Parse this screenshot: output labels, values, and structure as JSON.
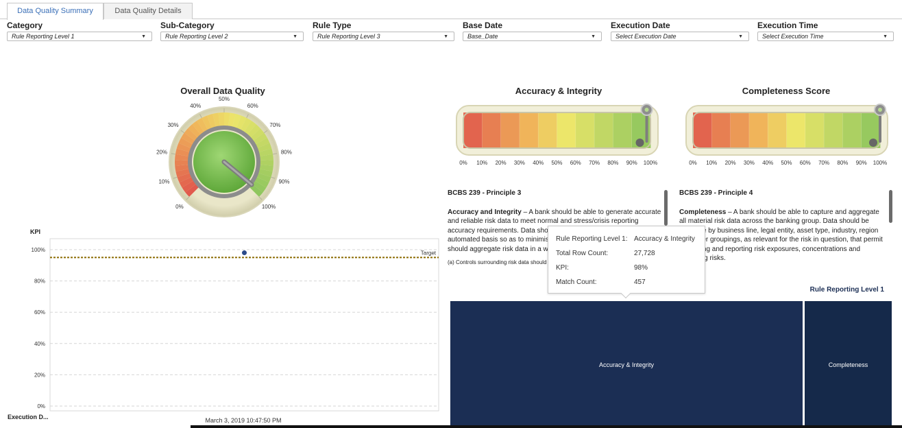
{
  "tabs": [
    {
      "label": "Data Quality Summary",
      "active": true
    },
    {
      "label": "Data Quality Details",
      "active": false
    }
  ],
  "filters": {
    "category": {
      "label": "Category",
      "value": "Rule Reporting Level 1"
    },
    "subcategory": {
      "label": "Sub-Category",
      "value": "Rule Reporting Level 2"
    },
    "rule_type": {
      "label": "Rule Type",
      "value": "Rule Reporting Level 3"
    },
    "base_date": {
      "label": "Base Date",
      "value": "Base_Date"
    },
    "execution_date": {
      "label": "Execution Date",
      "value": "Select Execution Date"
    },
    "execution_time": {
      "label": "Execution Time",
      "value": "Select Execution Time"
    }
  },
  "overall_gauge": {
    "title": "Overall Data Quality",
    "ticks": [
      "0%",
      "10%",
      "20%",
      "30%",
      "40%",
      "50%",
      "60%",
      "70%",
      "80%",
      "90%",
      "100%"
    ],
    "value": 0.98
  },
  "accuracy_bar": {
    "title": "Accuracy & Integrity",
    "ticks": [
      "0%",
      "10%",
      "20%",
      "30%",
      "40%",
      "50%",
      "60%",
      "70%",
      "80%",
      "90%",
      "100%"
    ],
    "value": 0.98
  },
  "completeness_bar": {
    "title": "Completeness Score",
    "ticks": [
      "0%",
      "10%",
      "20%",
      "30%",
      "40%",
      "50%",
      "60%",
      "70%",
      "80%",
      "90%",
      "100%"
    ],
    "value": 1.0
  },
  "principle3": {
    "title": "BCBS 239 - Principle 3",
    "lead": "Accuracy and Integrity",
    "body": " – A bank should be able to generate accurate and reliable risk data to meet normal and stress/crisis reporting accuracy requirements. Data should be aggregated on a largely automated basis so as to minimise the probability of errors. Banks should aggregate risk data in a way",
    "small": "(a) Controls surrounding risk data should be as robust as"
  },
  "principle4": {
    "title": "BCBS 239 - Principle 4",
    "lead": "Completeness",
    "body": " – A bank should be able to capture and aggregate all material risk data across the banking group. Data should be available by business line, legal entity, asset type, industry, region and other groupings, as relevant for the risk in question, that permit identifying and reporting risk exposures, concentrations and emerging risks."
  },
  "tooltip": {
    "rows": [
      {
        "label": "Rule Reporting Level 1:",
        "value": "Accuracy & Integrity"
      },
      {
        "label": "Total Row Count:",
        "value": "27,728"
      },
      {
        "label": "KPI:",
        "value": "98%"
      },
      {
        "label": "Match Count:",
        "value": "457"
      }
    ]
  },
  "treemap": {
    "legend_title": "Rule Reporting Level 1",
    "tiles": [
      {
        "label": "Accuracy & Integrity",
        "color": "#1b2e54"
      },
      {
        "label": "Completeness",
        "color": "#15294a"
      }
    ]
  },
  "kpi_chart": {
    "ylabel": "KPI",
    "xlabel": "Execution D...",
    "target_label": "Target",
    "yticks": [
      "0%",
      "20%",
      "40%",
      "60%",
      "80%",
      "100%"
    ],
    "category": "March 3, 2019 10:47:50 PM"
  },
  "chart_data": {
    "type": "scatter",
    "title": "",
    "ylabel": "KPI",
    "xlabel": "Execution D...",
    "categories": [
      "March 3, 2019 10:47:50 PM"
    ],
    "series": [
      {
        "values": [
          98
        ]
      }
    ],
    "target": 95,
    "ylim": [
      0,
      100
    ],
    "grid": true
  },
  "colors": {
    "accent": "#3a6fb7",
    "target_line": "#8a6a00",
    "point": "#2b4a8a",
    "treemap_dark": "#1b2e54"
  }
}
